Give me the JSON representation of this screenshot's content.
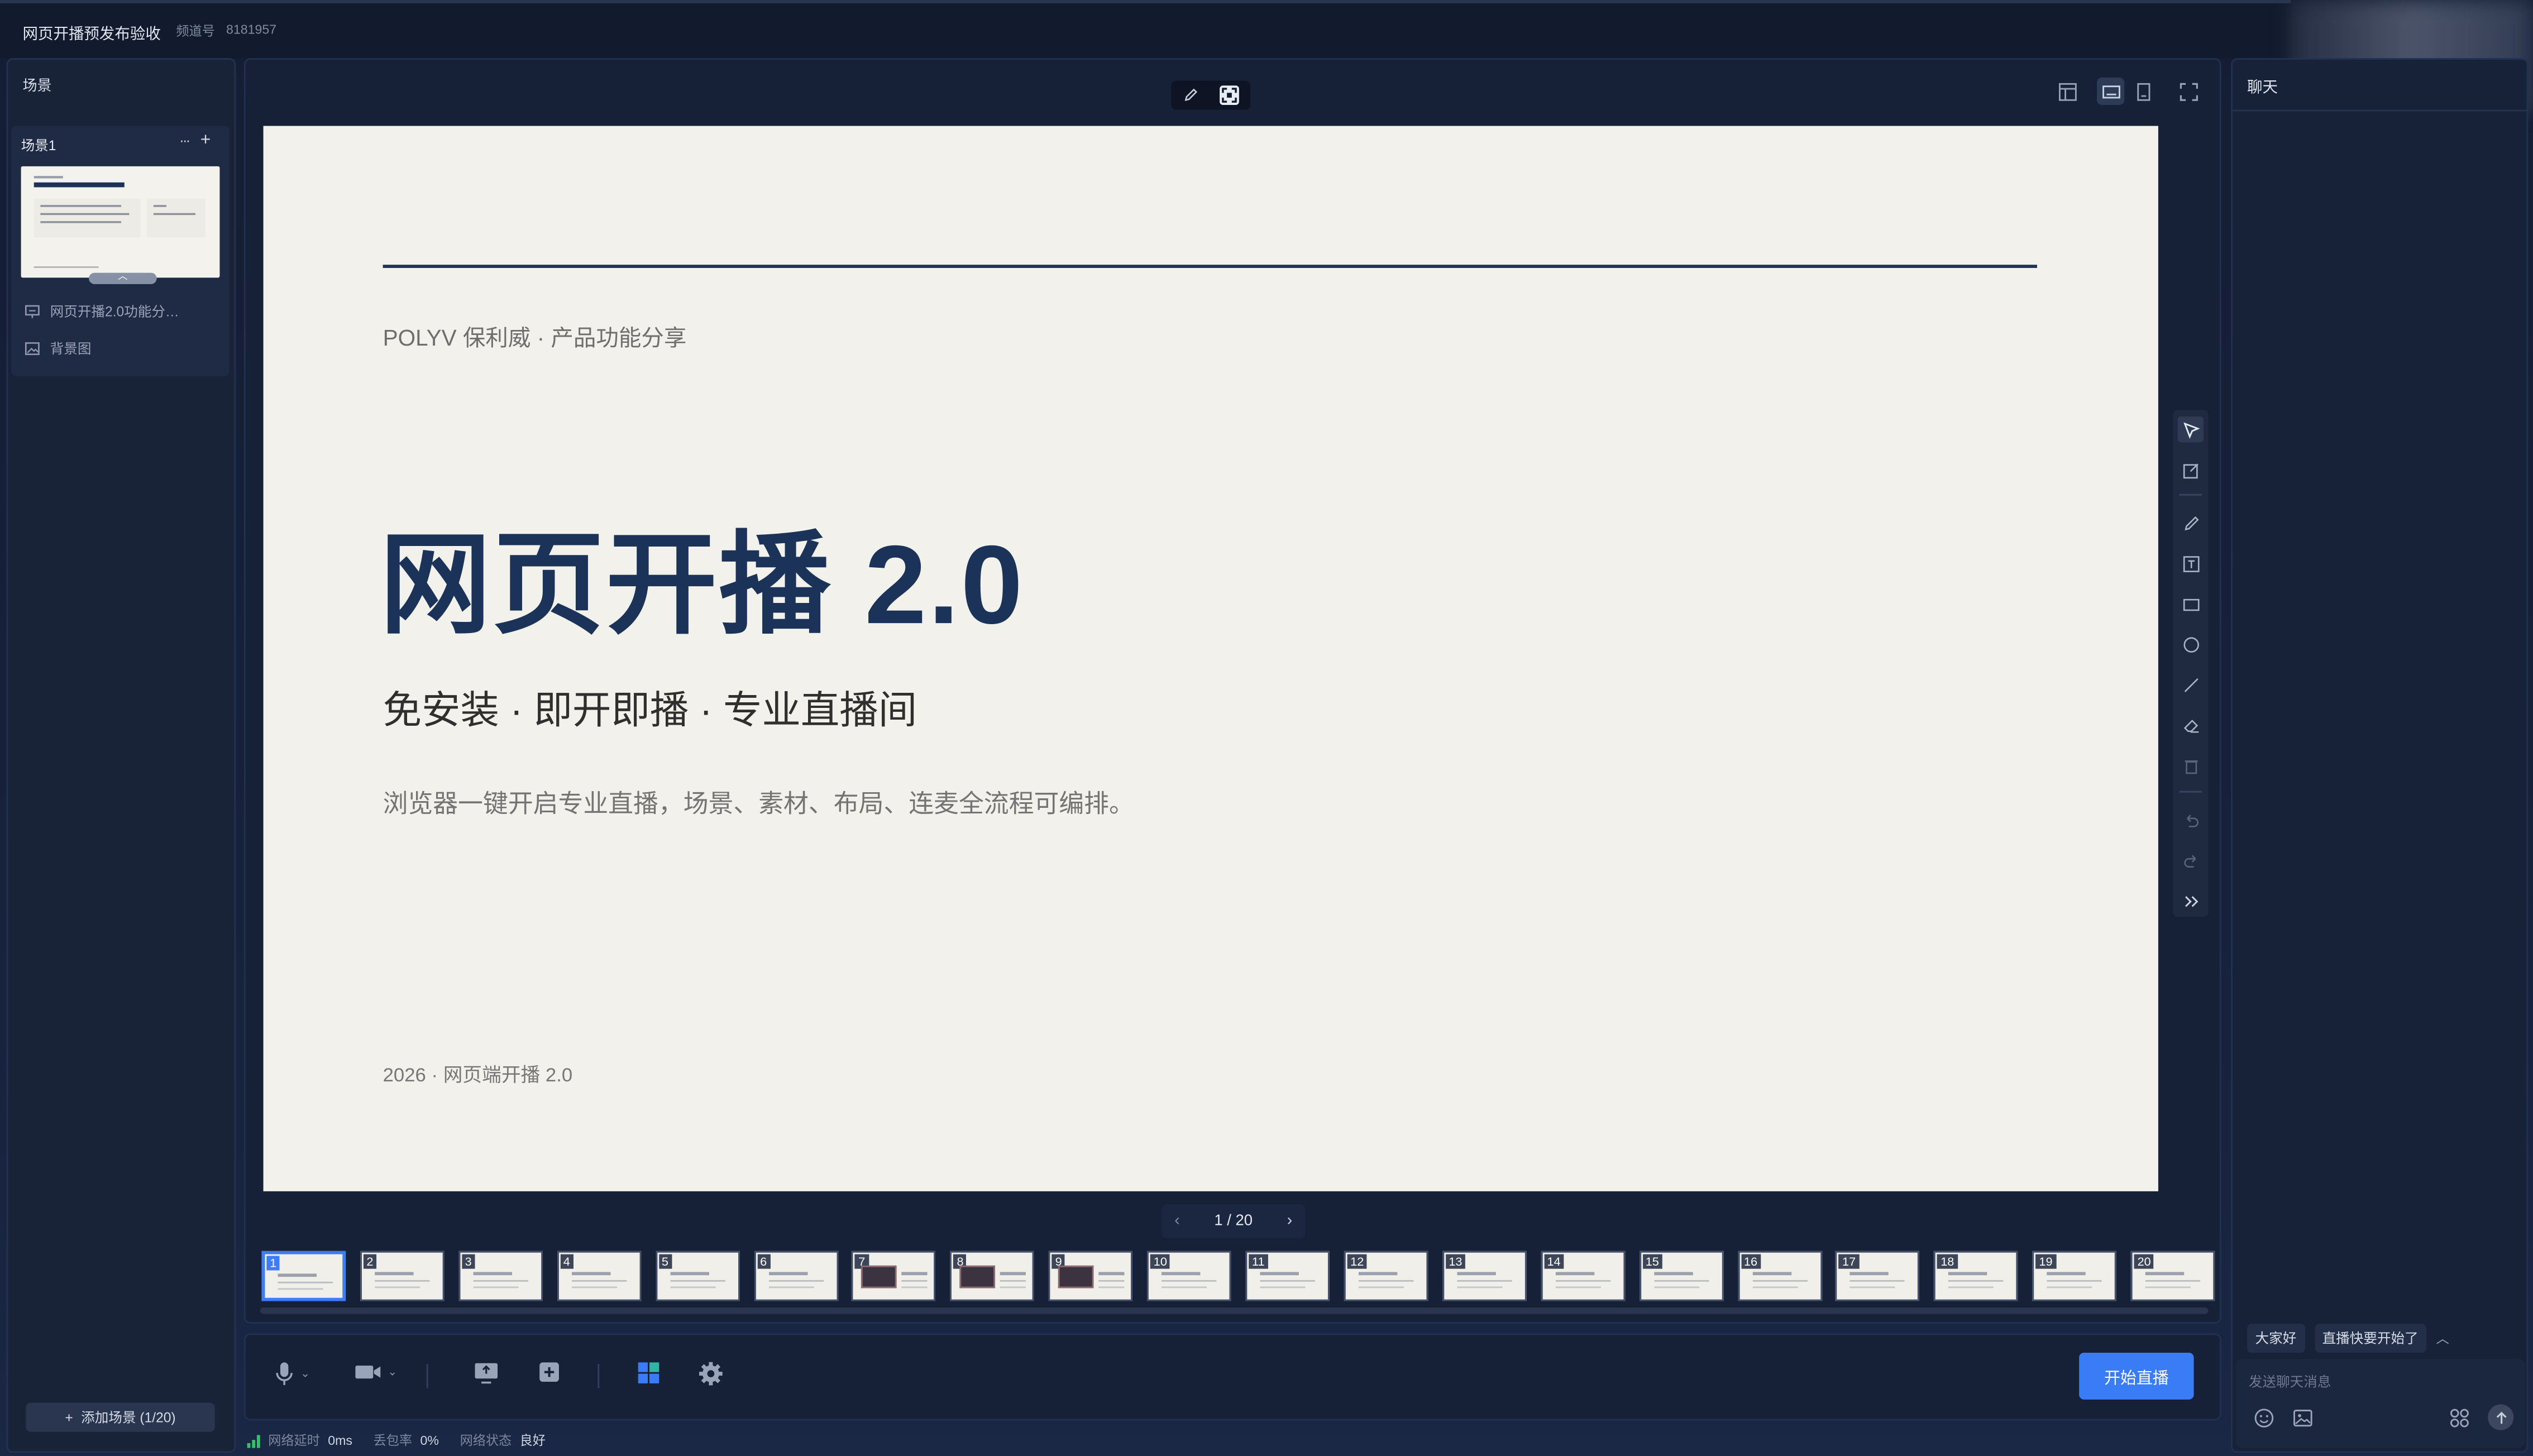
{
  "header": {
    "title": "网页开播预发布验收",
    "channel_label": "频道号",
    "channel_id": "8181957"
  },
  "scenes_panel": {
    "title": "场景",
    "scene": {
      "name": "场景1",
      "more_label": "···",
      "add_label": "+"
    },
    "assets": [
      {
        "label": "网页开播2.0功能分…",
        "icon": "presentation-icon"
      },
      {
        "label": "背景图",
        "icon": "image-icon"
      }
    ],
    "add_scene_label": "添加场景 (1/20)"
  },
  "slide": {
    "kicker": "POLYV 保利威 · 产品功能分享",
    "title": "网页开播 2.0",
    "subtitle": "免安装 · 即开即播 · 专业直播间",
    "description": "浏览器一键开启专业直播，场景、素材、布局、连麦全流程可编排。",
    "footer": "2026 · 网页端开播 2.0"
  },
  "pager": {
    "label": "1 / 20",
    "current": 1,
    "total": 20
  },
  "thumbnails": [
    "1",
    "2",
    "3",
    "4",
    "5",
    "6",
    "7",
    "8",
    "9",
    "10",
    "11",
    "12",
    "13",
    "14",
    "15",
    "16",
    "17",
    "18",
    "19",
    "20"
  ],
  "controls": {
    "start_label": "开始直播",
    "accent_color": "#3a7bf6"
  },
  "status": {
    "latency_label": "网络延时",
    "latency_value": "0ms",
    "loss_label": "丢包率",
    "loss_value": "0%",
    "net_label": "网络状态",
    "net_value": "良好",
    "good_color": "#35c06c"
  },
  "chat": {
    "title": "聊天",
    "quick_replies": [
      "大家好",
      "直播快要开始了"
    ],
    "placeholder": "发送聊天消息"
  }
}
